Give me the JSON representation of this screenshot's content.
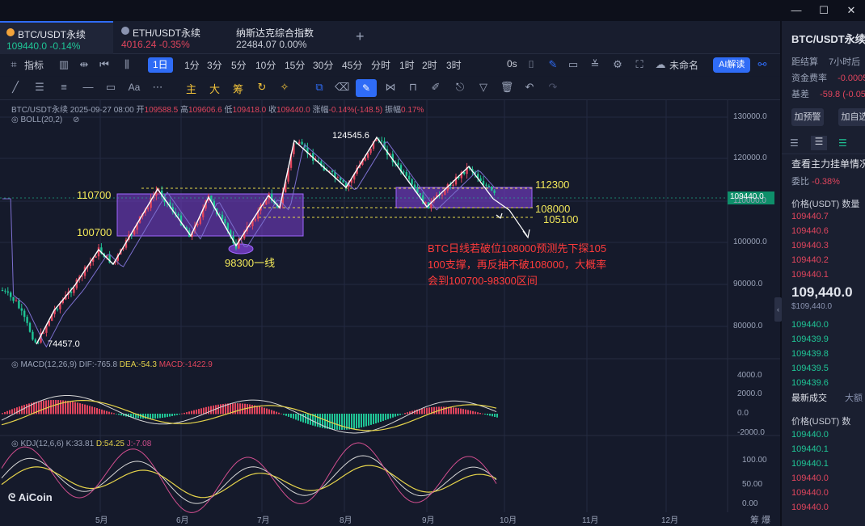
{
  "tabs": [
    {
      "name": "BTC/USDT永续",
      "price": "109440.0",
      "change": "-0.14%",
      "price_color": "#1fc596",
      "active": true,
      "coin_color": "#f2a33a"
    },
    {
      "name": "ETH/USDT永续",
      "price": "4016.24",
      "change": "-0.35%",
      "price_color": "#e0455d",
      "active": false,
      "coin_color": "#8a93b0"
    },
    {
      "name": "纳斯达克综合指数",
      "price": "22484.07",
      "change": "0.00%",
      "price_color": "#c9cdd8",
      "active": false
    }
  ],
  "add_tab": "+",
  "window_controls": [
    "—",
    "☐",
    "✕"
  ],
  "toolbar": {
    "indicator_label": "指标",
    "interval_selected": "1日",
    "intervals": [
      "1分",
      "3分",
      "5分",
      "10分",
      "15分",
      "30分",
      "45分",
      "分时",
      "1时",
      "2时",
      "3时"
    ],
    "zero_s": "0s",
    "layout_name": "未命名",
    "ai_button": "AI解读"
  },
  "draw_tools": {
    "zhu": "主",
    "da": "大",
    "chou": "筹"
  },
  "chart_header": {
    "symbol": "BTC/USDT永续",
    "datetime": "2025-09-27 08:00",
    "open_label": "开",
    "open": "109588.5",
    "high_label": "高",
    "high": "109606.6",
    "low_label": "低",
    "low": "109418.0",
    "close_label": "收",
    "close": "109440.0",
    "change_label": "涨幅",
    "change": "-0.14%(-148.5)",
    "amp_label": "振幅",
    "amp": "0.17%",
    "boll": "BOLL(20,2)"
  },
  "macd_header": {
    "name": "MACD(12,26,9)",
    "dif": "DIF:-765.8",
    "dea": "DEA:-54.3",
    "macd": "MACD:-1422.9"
  },
  "kdj_header": {
    "name": "KDJ(12,6,6)",
    "k": "K:33.81",
    "d": "D:54.25",
    "j": "J:-7.08"
  },
  "price_axis": [
    "130000.0",
    "120000.0",
    "110000.0",
    "100000.0",
    "90000.0",
    "80000.0"
  ],
  "current_price_tag": "109440.0",
  "macd_axis": [
    "4000.0",
    "2000.0",
    "0.0",
    "-2000.0"
  ],
  "kdj_axis": [
    "100.00",
    "50.00",
    "0.00"
  ],
  "time_axis": [
    "5月",
    "6月",
    "7月",
    "8月",
    "9月",
    "10月",
    "11月",
    "12月"
  ],
  "annotations": {
    "peak": "124545.6",
    "low": "74457.0",
    "l110700": "110700",
    "l100700": "100700",
    "l98300": "98300一线",
    "l112300": "112300",
    "l108000": "108000",
    "l105100": "105100",
    "note1": "BTC日线若破位108000预测先下探105",
    "note2": "100支撑，再反抽不破108000，大概率",
    "note3": "会到100700-98300区间"
  },
  "watermark": "AiCoin",
  "corner_text": "筹 爆",
  "panel": {
    "title": "BTC/USDT永续",
    "settle_label": "距结算",
    "settle_value": "7小时后",
    "funding_label": "资金费率",
    "funding_value": "-0.0005",
    "basis_label": "基差",
    "basis_value": "-59.8 (-0.05",
    "btn_alert": "加预警",
    "btn_add": "加自选",
    "depth_title": "查看主力挂单情况",
    "ratio_label": "委比",
    "ratio_value": "-0.38%",
    "book_header": "价格(USDT)  数量",
    "asks": [
      "109440.7",
      "109440.6",
      "109440.3",
      "109440.2",
      "109440.1"
    ],
    "last_price": "109,440.0",
    "last_price_sub": "$109,440.0",
    "bids": [
      "109440.0",
      "109439.9",
      "109439.8",
      "109439.5",
      "109439.6"
    ],
    "trades_tab": "最新成交",
    "trades_tab2": "大额",
    "trades_header": "价格(USDT)  数",
    "trades": [
      {
        "p": "109440.0",
        "side": "buy"
      },
      {
        "p": "109440.1",
        "side": "buy"
      },
      {
        "p": "109440.1",
        "side": "buy"
      },
      {
        "p": "109440.0",
        "side": "sell"
      },
      {
        "p": "109440.0",
        "side": "sell"
      },
      {
        "p": "109440.0",
        "side": "sell"
      }
    ]
  },
  "colors": {
    "up": "#e0455d",
    "down": "#1fc596",
    "accent": "#2f6cf6",
    "annotation": "#f3e95a",
    "note": "#ff3b3b",
    "box": "#7b3fd1"
  }
}
